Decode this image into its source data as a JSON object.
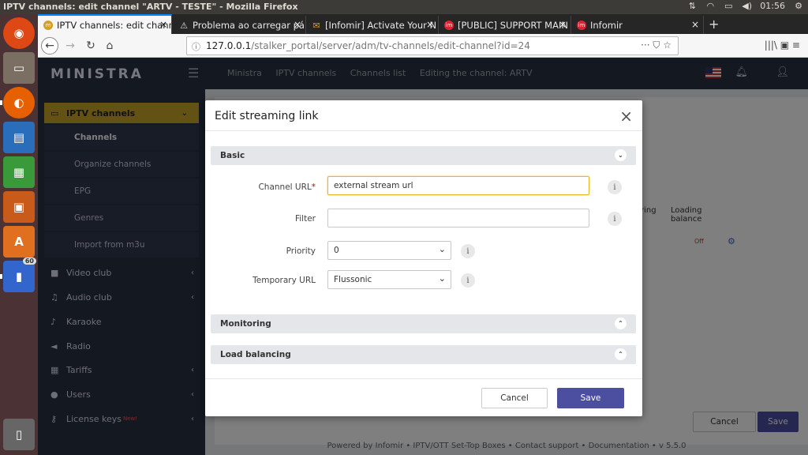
{
  "os": {
    "window_title": "IPTV channels: edit channel \"ARTV - TESTE\" - Mozilla Firefox",
    "tray": {
      "network": "⇅",
      "wifi": "◠",
      "battery": "▭",
      "volume": "◀)",
      "clock": "01:56",
      "power": "⚙"
    },
    "launcher": [
      {
        "name": "ubuntu-logo",
        "glyph": "◉",
        "color": "#dd4814"
      },
      {
        "name": "files",
        "glyph": "▭",
        "color": "#8a7a6a"
      },
      {
        "name": "firefox",
        "glyph": "◐",
        "color": "#e66000"
      },
      {
        "name": "writer",
        "glyph": "▤",
        "color": "#2a6ebb"
      },
      {
        "name": "calc",
        "glyph": "▦",
        "color": "#3a9a3a"
      },
      {
        "name": "impress",
        "glyph": "▣",
        "color": "#c85a1a"
      },
      {
        "name": "software",
        "glyph": "A",
        "color": "#e07020"
      },
      {
        "name": "updater",
        "glyph": "▮",
        "color": "#3366cc",
        "badge": "60"
      },
      {
        "name": "trash",
        "glyph": "🗑",
        "color": "#666"
      }
    ]
  },
  "browser": {
    "tabs": [
      {
        "label": "IPTV channels: edit chann",
        "icon": "m",
        "icon_color": "#d4a020",
        "active": true
      },
      {
        "label": "Problema ao carregar pá",
        "icon": "⚠",
        "icon_color": "#444",
        "active": false
      },
      {
        "label": "[Infomir] Activate Your N",
        "icon": "✉",
        "icon_color": "#d4a020",
        "active": false
      },
      {
        "label": "[PUBLIC] SUPPORT MAIN",
        "icon": "im",
        "icon_color": "#d23",
        "active": false
      },
      {
        "label": "Infomir",
        "icon": "im",
        "icon_color": "#d23",
        "active": false
      }
    ],
    "url_host": "127.0.0.1",
    "url_path": "/stalker_portal/server/adm/tv-channels/edit-channel?id=24",
    "url_actions": "···  ⛉  ☆",
    "toolbar_right": "|||\\  ▣  ≡"
  },
  "app": {
    "logo": "MINISTRA",
    "breadcrumb": [
      "Ministra",
      "IPTV channels",
      "Channels list",
      "Editing the channel: ARTV"
    ],
    "sidebar": [
      {
        "label": "IPTV channels",
        "icon": "▭",
        "active": true,
        "chevron": "⌄"
      },
      {
        "label": "Video club",
        "icon": "■",
        "chevron": "‹"
      },
      {
        "label": "Audio club",
        "icon": "♫",
        "chevron": "‹"
      },
      {
        "label": "Karaoke",
        "icon": "♪",
        "chevron": ""
      },
      {
        "label": "Radio",
        "icon": "◄",
        "chevron": ""
      },
      {
        "label": "Tariffs",
        "icon": "▦",
        "chevron": "‹"
      },
      {
        "label": "Users",
        "icon": "●",
        "chevron": "‹"
      },
      {
        "label": "License keys",
        "icon": "⚷",
        "chevron": "‹",
        "tag": "New!"
      }
    ],
    "submenu": [
      "Channels",
      "Organize channels",
      "EPG",
      "Genres",
      "Import from m3u"
    ],
    "footer": "Powered by Infomir • IPTV/OTT Set-Top Boxes • Contact support • Documentation • v 5.5.0",
    "bg_cancel": "Cancel",
    "bg_save": "Save",
    "bg_columns": [
      "toring",
      "Loading balance"
    ],
    "bg_status": "Off"
  },
  "modal": {
    "title": "Edit streaming link",
    "close": "×",
    "sections": {
      "basic": {
        "label": "Basic",
        "toggle": "⌄"
      },
      "monitoring": {
        "label": "Monitoring",
        "toggle": "⌃"
      },
      "load_balancing": {
        "label": "Load balancing",
        "toggle": "⌃"
      }
    },
    "fields": {
      "channel_url": {
        "label": "Channel URL",
        "required": "*",
        "value": "external stream url"
      },
      "filter": {
        "label": "Filter",
        "value": ""
      },
      "priority": {
        "label": "Priority",
        "value": "0"
      },
      "temporary_url": {
        "label": "Temporary URL",
        "value": "Flussonic"
      }
    },
    "info_glyph": "i",
    "cancel_label": "Cancel",
    "save_label": "Save"
  }
}
